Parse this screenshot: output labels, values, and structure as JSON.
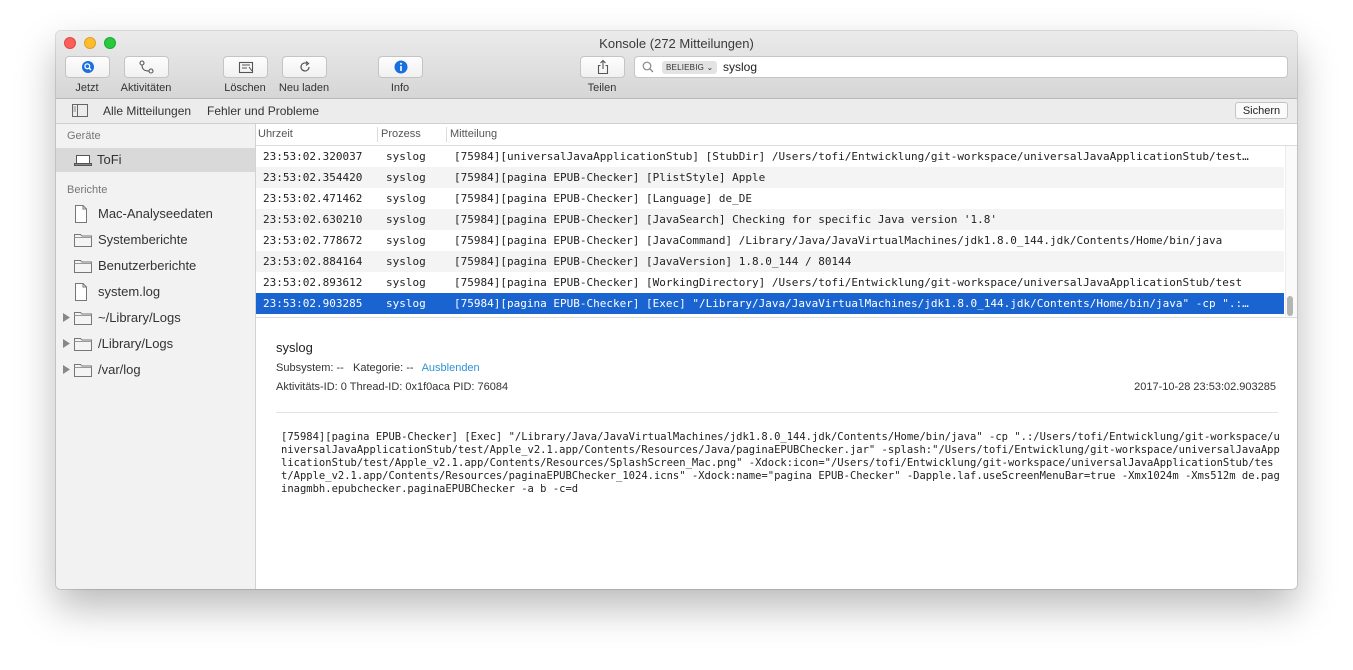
{
  "window": {
    "title": "Konsole (272 Mitteilungen)"
  },
  "toolbar": {
    "now_label": "Jetzt",
    "activities_label": "Aktivitäten",
    "clear_label": "Löschen",
    "reload_label": "Neu laden",
    "info_label": "Info",
    "share_label": "Teilen",
    "search_token": "BELIEBIG",
    "search_term": "syslog"
  },
  "filterbar": {
    "all_messages": "Alle Mitteilungen",
    "errors_faults": "Fehler und Probleme",
    "save_label": "Sichern"
  },
  "sidebar": {
    "devices_header": "Geräte",
    "device_name": "ToFi",
    "reports_header": "Berichte",
    "items": [
      {
        "label": "Mac-Analyseedaten",
        "icon": "document-icon"
      },
      {
        "label": "Systemberichte",
        "icon": "folder-icon"
      },
      {
        "label": "Benutzerberichte",
        "icon": "folder-icon"
      },
      {
        "label": "system.log",
        "icon": "document-icon"
      },
      {
        "label": "~/Library/Logs",
        "icon": "folder-icon"
      },
      {
        "label": "/Library/Logs",
        "icon": "folder-icon"
      },
      {
        "label": "/var/log",
        "icon": "folder-icon"
      }
    ]
  },
  "table": {
    "columns": [
      "Uhrzeit",
      "Prozess",
      "Mitteilung"
    ],
    "rows": [
      {
        "time": "23:53:02.320037",
        "process": "syslog",
        "message": "[75984][universalJavaApplicationStub] [StubDir] /Users/tofi/Entwicklung/git-workspace/universalJavaApplicationStub/test…"
      },
      {
        "time": "23:53:02.354420",
        "process": "syslog",
        "message": "[75984][pagina EPUB-Checker] [PlistStyle] Apple"
      },
      {
        "time": "23:53:02.471462",
        "process": "syslog",
        "message": "[75984][pagina EPUB-Checker] [Language] de_DE"
      },
      {
        "time": "23:53:02.630210",
        "process": "syslog",
        "message": "[75984][pagina EPUB-Checker] [JavaSearch] Checking for specific Java version '1.8'"
      },
      {
        "time": "23:53:02.778672",
        "process": "syslog",
        "message": "[75984][pagina EPUB-Checker] [JavaCommand] /Library/Java/JavaVirtualMachines/jdk1.8.0_144.jdk/Contents/Home/bin/java"
      },
      {
        "time": "23:53:02.884164",
        "process": "syslog",
        "message": "[75984][pagina EPUB-Checker] [JavaVersion] 1.8.0_144 / 80144"
      },
      {
        "time": "23:53:02.893612",
        "process": "syslog",
        "message": "[75984][pagina EPUB-Checker] [WorkingDirectory] /Users/tofi/Entwicklung/git-workspace/universalJavaApplicationStub/test"
      },
      {
        "time": "23:53:02.903285",
        "process": "syslog",
        "message": "[75984][pagina EPUB-Checker] [Exec] \"/Library/Java/JavaVirtualMachines/jdk1.8.0_144.jdk/Contents/Home/bin/java\" -cp \".:…"
      }
    ],
    "selected_index": 7
  },
  "detail": {
    "title": "syslog",
    "subsystem": "Subsystem: --",
    "category": "Kategorie: --",
    "hide_link": "Ausblenden",
    "ids": "Aktivitäts-ID: 0   Thread-ID: 0x1f0aca   PID: 76084",
    "timestamp": "2017-10-28 23:53:02.903285",
    "message": "[75984][pagina EPUB-Checker] [Exec] \"/Library/Java/JavaVirtualMachines/jdk1.8.0_144.jdk/Contents/Home/bin/java\" -cp \".:/Users/tofi/Entwicklung/git-workspace/universalJavaApplicationStub/test/Apple_v2.1.app/Contents/Resources/Java/paginaEPUBChecker.jar\" -splash:\"/Users/tofi/Entwicklung/git-workspace/universalJavaApplicationStub/test/Apple_v2.1.app/Contents/Resources/SplashScreen_Mac.png\" -Xdock:icon=\"/Users/tofi/Entwicklung/git-workspace/universalJavaApplicationStub/test/Apple_v2.1.app/Contents/Resources/paginaEPUBChecker_1024.icns\" -Xdock:name=\"pagina EPUB-Checker\" -Dapple.laf.useScreenMenuBar=true -Xmx1024m -Xms512m de.paginagmbh.epubchecker.paginaEPUBChecker -a b -c=d"
  },
  "colors": {
    "selection": "#1a64d1",
    "link": "#2f93d6",
    "info_icon": "#1a6fe0"
  }
}
